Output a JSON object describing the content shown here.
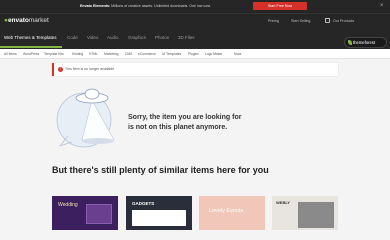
{
  "promo": {
    "brand": "Envato Elements:",
    "message": "Millions of creative assets. Unlimited downloads. One low cost.",
    "cta": "Start Free Now"
  },
  "header": {
    "logo": "envato",
    "logo_suffix": "market",
    "links": [
      "Pricing",
      "Start Selling",
      "Our Products"
    ]
  },
  "categories": {
    "items": [
      "Web Themes & Templates",
      "Code",
      "Video",
      "Audio",
      "Graphics",
      "Photos",
      "3D Files"
    ],
    "active_index": 0
  },
  "badge": {
    "label": "themeforest"
  },
  "subnav": {
    "items": [
      "All Items",
      "WordPress",
      "Template Kits",
      "Hosting",
      "HTML",
      "Marketing",
      "CMS",
      "eCommerce",
      "UI Templates",
      "Plugins",
      "Logo Maker",
      "More"
    ]
  },
  "notice": {
    "text": "This item is no longer available"
  },
  "error": {
    "line1": "Sorry, the item you are looking for",
    "line2": "is not on this planet anymore."
  },
  "similar": {
    "heading": "But there's still plenty of similar items here for you"
  },
  "thumbnails": [
    {
      "title": "Wedding",
      "color": "#3c1f5e"
    },
    {
      "title": "GADGETS",
      "color": "#2a2e3a"
    },
    {
      "title": "Lovely Events",
      "color": "#f1c7b9"
    },
    {
      "title": "WEBLY",
      "color": "#e8e4df"
    }
  ]
}
